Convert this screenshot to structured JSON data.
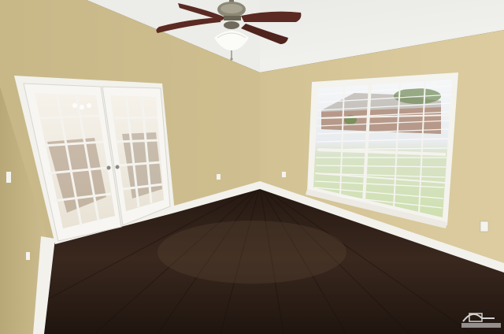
{
  "scene": {
    "description_hidden": "",
    "colors": {
      "ceiling": "#efefec",
      "wall_left": "#c9b98a",
      "wall_back": "#d3c394",
      "wall_right": "#d8c89b",
      "floor": "#2d1f17",
      "trim": "#f2f1ec",
      "fan_blade": "#5b2a22",
      "glass": "#f3efe6"
    },
    "icons": {
      "ceiling_fan": "ceiling-fan-icon",
      "logo": "house-logo-icon"
    }
  }
}
